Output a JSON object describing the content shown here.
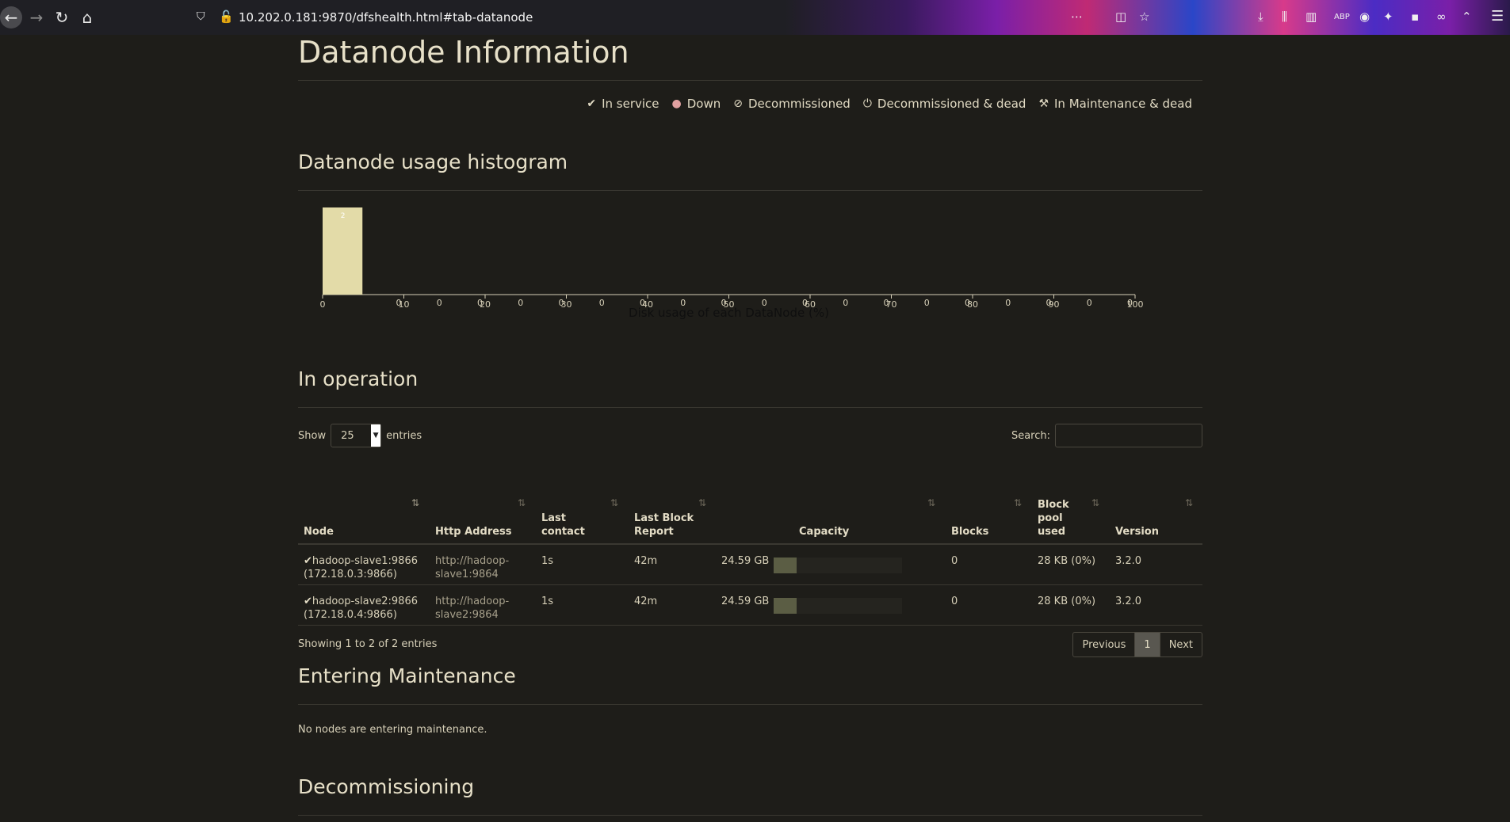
{
  "browser": {
    "url": "10.202.0.181:9870/dfshealth.html#tab-datanode",
    "icons": [
      "back-icon",
      "forward-icon",
      "reload-icon",
      "home-icon",
      "shield-icon",
      "insecure-lock-icon",
      "download-icon",
      "library-icon",
      "sidebar-icon",
      "abp-icon",
      "pocket-icon",
      "bookmark-star-icon",
      "menu-icon"
    ]
  },
  "page": {
    "title": "Datanode Information",
    "legend": [
      {
        "icon": "✔",
        "label": "In service"
      },
      {
        "icon": "❗",
        "label": "Down"
      },
      {
        "icon": "⊘",
        "label": "Decommissioned"
      },
      {
        "icon": "⏻",
        "label": "Decommissioned & dead"
      },
      {
        "icon": "🔧",
        "label": "In Maintenance & dead"
      }
    ]
  },
  "histogram": {
    "title": "Datanode usage histogram",
    "xlabel": "Disk usage of each DataNode (%)"
  },
  "chart_data": {
    "type": "bar",
    "title": "Datanode usage histogram",
    "xlabel": "Disk usage of each DataNode (%)",
    "ylabel": "",
    "bins": [
      [
        0,
        5
      ],
      [
        5,
        10
      ],
      [
        10,
        15
      ],
      [
        15,
        20
      ],
      [
        20,
        25
      ],
      [
        25,
        30
      ],
      [
        30,
        35
      ],
      [
        35,
        40
      ],
      [
        40,
        45
      ],
      [
        45,
        50
      ],
      [
        50,
        55
      ],
      [
        55,
        60
      ],
      [
        60,
        65
      ],
      [
        65,
        70
      ],
      [
        70,
        75
      ],
      [
        75,
        80
      ],
      [
        80,
        85
      ],
      [
        85,
        90
      ],
      [
        90,
        95
      ],
      [
        95,
        100
      ]
    ],
    "values": [
      2,
      0,
      0,
      0,
      0,
      0,
      0,
      0,
      0,
      0,
      0,
      0,
      0,
      0,
      0,
      0,
      0,
      0,
      0,
      0
    ],
    "xticks": [
      0,
      10,
      20,
      30,
      40,
      50,
      60,
      70,
      80,
      90,
      100
    ],
    "xlim": [
      0,
      100
    ],
    "ylim": [
      0,
      2
    ]
  },
  "in_operation": {
    "title": "In operation",
    "show_label": "Show",
    "entries_label": "entries",
    "page_size": "25",
    "search_label": "Search:",
    "search_value": "",
    "columns": [
      "Node",
      "Http Address",
      "Last contact",
      "Last Block Report",
      "Capacity",
      "Blocks",
      "Block pool used",
      "Version"
    ],
    "rows": [
      {
        "node": "hadoop-slave1:9866",
        "node_ip": "(172.18.0.3:9866)",
        "http1": "http://hadoop-",
        "http2": "slave1:9864",
        "last_contact": "1s",
        "last_block_report": "42m",
        "capacity": "24.59 GB",
        "capacity_used_pct": 0.18,
        "blocks": "0",
        "block_pool_used": "28 KB (0%)",
        "version": "3.2.0"
      },
      {
        "node": "hadoop-slave2:9866",
        "node_ip": "(172.18.0.4:9866)",
        "http1": "http://hadoop-",
        "http2": "slave2:9864",
        "last_contact": "1s",
        "last_block_report": "42m",
        "capacity": "24.59 GB",
        "capacity_used_pct": 0.18,
        "blocks": "0",
        "block_pool_used": "28 KB (0%)",
        "version": "3.2.0"
      }
    ],
    "showing": "Showing 1 to 2 of 2 entries",
    "pagination": {
      "previous": "Previous",
      "current": "1",
      "next": "Next"
    }
  },
  "entering_maintenance": {
    "title": "Entering Maintenance",
    "message": "No nodes are entering maintenance."
  },
  "decommissioning": {
    "title": "Decommissioning"
  }
}
